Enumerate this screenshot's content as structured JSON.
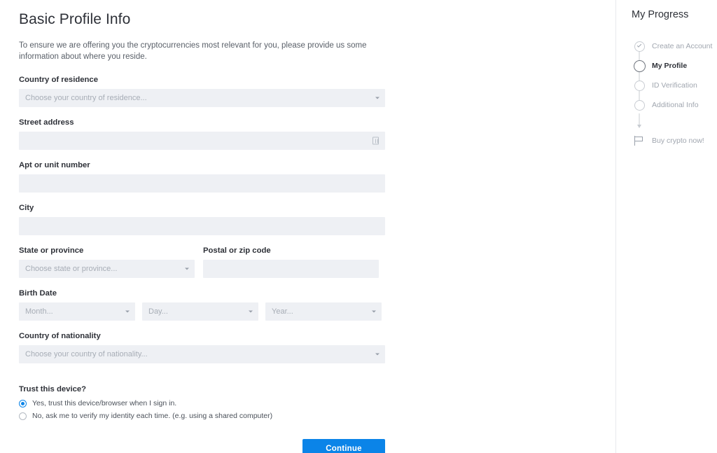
{
  "form": {
    "title": "Basic Profile Info",
    "intro": "To ensure we are offering you the cryptocurrencies most relevant for you, please provide us some information about where you reside.",
    "fields": {
      "country_residence": {
        "label": "Country of residence",
        "placeholder": "Choose your country of residence...",
        "value": "",
        "icon": "chevron-down-icon"
      },
      "street_address": {
        "label": "Street address",
        "placeholder": "",
        "value": "",
        "icon": "address-lookup-icon"
      },
      "apt_unit": {
        "label": "Apt or unit number",
        "placeholder": "",
        "value": ""
      },
      "city": {
        "label": "City",
        "placeholder": "",
        "value": ""
      },
      "state_province": {
        "label": "State or province",
        "placeholder": "Choose state or province...",
        "value": "",
        "icon": "chevron-down-icon"
      },
      "postal_zip": {
        "label": "Postal or zip code",
        "placeholder": "",
        "value": ""
      },
      "birth_date": {
        "label": "Birth Date",
        "month_placeholder": "Month...",
        "day_placeholder": "Day...",
        "year_placeholder": "Year...",
        "month_value": "",
        "day_value": "",
        "year_value": ""
      },
      "country_nationality": {
        "label": "Country of nationality",
        "placeholder": "Choose your country of nationality...",
        "value": "",
        "icon": "chevron-down-icon"
      }
    },
    "trust_device": {
      "label": "Trust this device?",
      "options": [
        {
          "label": "Yes, trust this device/browser when I sign in.",
          "selected": true
        },
        {
          "label": "No, ask me to verify my identity each time. (e.g. using a shared computer)",
          "selected": false
        }
      ]
    },
    "continue_label": "Continue"
  },
  "progress": {
    "title": "My Progress",
    "steps": [
      {
        "label": "Create an Account",
        "state": "complete"
      },
      {
        "label": "My Profile",
        "state": "current"
      },
      {
        "label": "ID Verification",
        "state": "pending"
      },
      {
        "label": "Additional Info",
        "state": "pending"
      }
    ],
    "goal": {
      "label": "Buy crypto now!",
      "icon": "flag-icon"
    }
  },
  "colors": {
    "accent": "#0b84e8",
    "field_bg": "#eef0f4",
    "text_dark": "#2e3138",
    "text_muted": "#a0a6af",
    "divider": "#e8eaed"
  }
}
